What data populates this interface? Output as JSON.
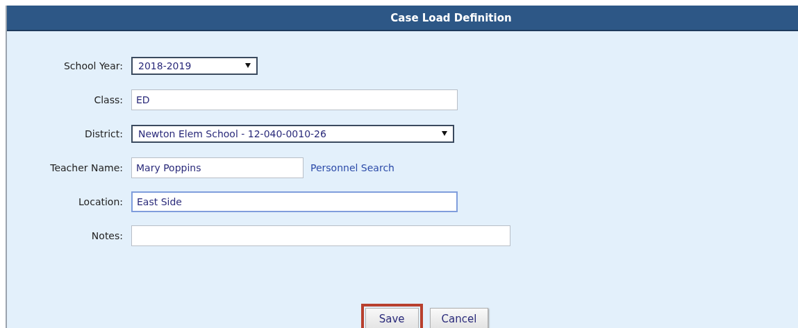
{
  "title": "Case Load Definition",
  "fields": [
    {
      "label": "School Year:",
      "kind": "select",
      "value": "2018-2019",
      "focused": false
    },
    {
      "label": "Class:",
      "kind": "text",
      "value": "ED",
      "focused": false
    },
    {
      "label": "District:",
      "kind": "select",
      "value": "Newton Elem School - 12-040-0010-26",
      "focused": false
    },
    {
      "label": "Teacher Name:",
      "kind": "text",
      "value": "Mary Poppins",
      "focused": false,
      "link": "Personnel Search"
    },
    {
      "label": "Location:",
      "kind": "text",
      "value": "East Side",
      "focused": true
    },
    {
      "label": "Notes:",
      "kind": "text",
      "focused": false
    }
  ],
  "buttons": [
    {
      "label": "Save",
      "highlighted": true
    },
    {
      "label": "Cancel",
      "highlighted": false
    }
  ]
}
